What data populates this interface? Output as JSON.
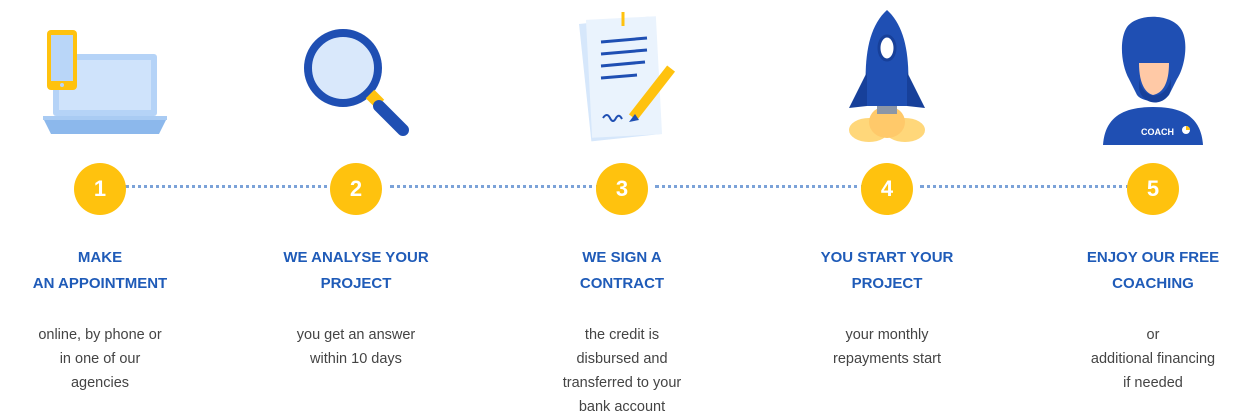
{
  "steps": [
    {
      "number": "1",
      "title": "MAKE\nAN APPOINTMENT",
      "description": "online, by phone or\nin one of our\nagencies",
      "icon": "laptop-phone-icon"
    },
    {
      "number": "2",
      "title": "WE ANALYSE YOUR\nPROJECT",
      "description": "you get an answer\nwithin 10 days",
      "icon": "magnifying-glass-icon"
    },
    {
      "number": "3",
      "title": "WE SIGN A\nCONTRACT",
      "description": "the credit is\ndisbursed and\ntransferred to your\nbank account",
      "icon": "contract-pen-icon"
    },
    {
      "number": "4",
      "title": "YOU START YOUR\nPROJECT",
      "description": "your monthly\nrepayments start",
      "icon": "rocket-icon"
    },
    {
      "number": "5",
      "title": "ENJOY OUR FREE\nCOACHING",
      "description": "or\nadditional financing\nif needed",
      "icon": "coach-icon",
      "shirt_label": "COACH"
    }
  ],
  "colors": {
    "badge": "#ffc20e",
    "title": "#1f5bb8",
    "text": "#444444",
    "connector": "#7ba2d8",
    "primary_blue": "#1f4fb3",
    "light_blue": "#b5d3f7"
  }
}
